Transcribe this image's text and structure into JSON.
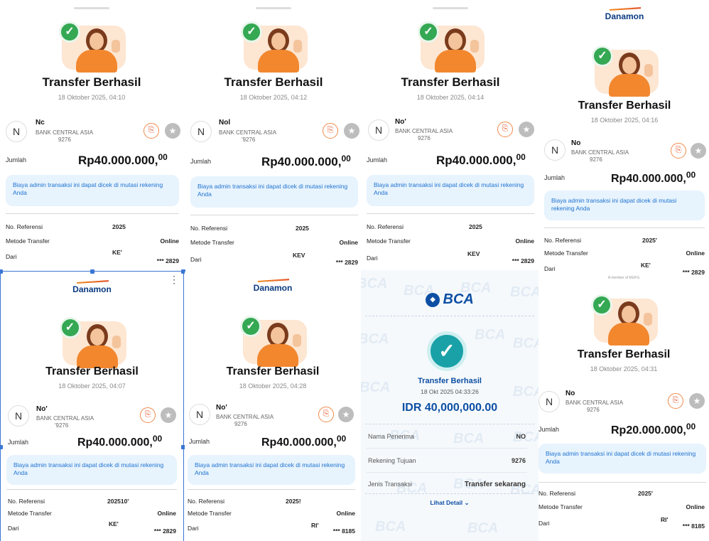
{
  "common": {
    "title": "Transfer Berhasil",
    "brand": "Danamon",
    "brand_sub": "A member of MUFG",
    "bank": "BANK CENTRAL ASIA",
    "amount_label": "Jumlah",
    "info": "Biaya admin transaksi ini dapat dicek di mutasi rekening Anda",
    "ref_label": "No. Referensi",
    "method_label": "Metode Transfer",
    "method_value": "Online",
    "from_label": "Dari",
    "avatar_letter": "N"
  },
  "receipts": [
    {
      "date": "18 Oktober 2025, 04:10",
      "name": "Nc",
      "acct": "9276",
      "amount": "Rp40.000.000,",
      "cents": "00",
      "ref": "2025",
      "from_name": "KE'",
      "from_acct": "*** 2829"
    },
    {
      "date": "18 Oktober 2025, 04:12",
      "name": "Nol",
      "acct": "'9276",
      "amount": "Rp40.000.000,",
      "cents": "00",
      "ref": "2025",
      "from_name": "KEV",
      "from_acct": "*** 2829"
    },
    {
      "date": "18 Oktober 2025, 04:14",
      "name": "No'",
      "acct": "9276",
      "amount": "Rp40.000.000,",
      "cents": "00",
      "ref": "2025",
      "from_name": "KEV",
      "from_acct": "*** 2829"
    },
    {
      "date": "18 Oktober 2025, 04:16",
      "name": "No",
      "acct": "9276",
      "amount": "Rp40.000.000,",
      "cents": "00",
      "ref": "2025'",
      "from_name": "KE'",
      "from_acct": "*** 2829"
    },
    {
      "date": "18 Oktober 2025, 04:07",
      "name": "No'",
      "acct": "'9276",
      "amount": "Rp40.000.000,",
      "cents": "00",
      "ref": "202510'",
      "from_name": "KE'",
      "from_acct": "*** 2829"
    },
    {
      "date": "18 Oktober 2025, 04:28",
      "name": "No'",
      "acct": "9276",
      "amount": "Rp40.000.000,",
      "cents": "00",
      "ref": "2025!",
      "from_name": "RI'",
      "from_acct": "*** 8185"
    },
    {
      "date": "18 Oktober 2025, 04:31",
      "name": "No",
      "acct": "9276",
      "amount": "Rp20.000.000,",
      "cents": "00",
      "ref": "2025'",
      "from_name": "RI'",
      "from_acct": "*** 8185"
    }
  ],
  "bca": {
    "logo": "BCA",
    "watermark": "BCA",
    "title": "Transfer Berhasil",
    "date": "18 Okt 2025 04:33:26",
    "amount": "IDR 40,000,000.00",
    "rows": [
      {
        "label": "Nama Penerima",
        "value": "NO"
      },
      {
        "label": "Rekening Tujuan",
        "value": "9276"
      },
      {
        "label": "Jenis Transaksi",
        "value": "Transfer sekarang"
      }
    ],
    "details_link": "Lihat Detail"
  },
  "icons": {
    "check": "check-icon",
    "bookmark": "add-favorite-icon",
    "star": "star-icon",
    "menu": "more-vert-icon",
    "chevron": "chevron-down-icon"
  },
  "colors": {
    "success": "#34a853",
    "info_bg": "#e7f3fd",
    "info_text": "#1f73d0",
    "bca_blue": "#0d4fa3",
    "danamon_blue": "#0a3a82",
    "orange": "#f08a1d"
  }
}
